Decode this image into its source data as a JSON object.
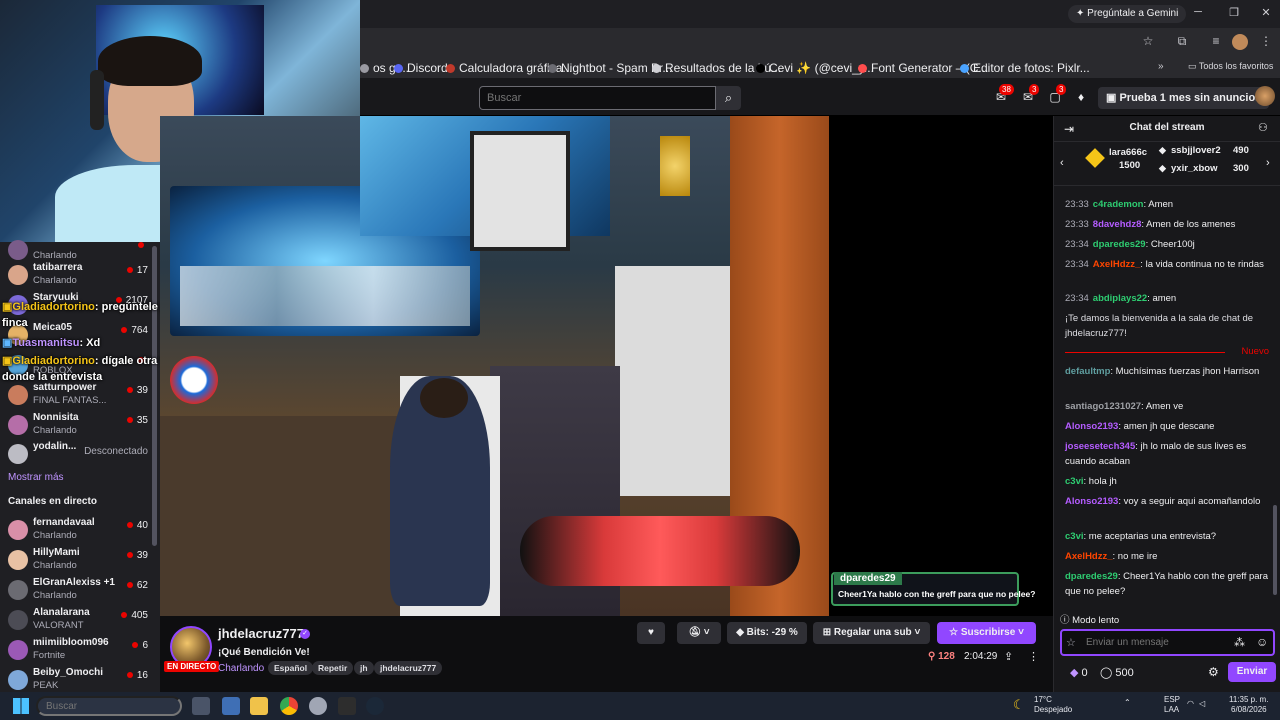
{
  "browser": {
    "gemini_label": "Pregúntale a Gemini",
    "bookmarks": [
      {
        "label": "os gr...",
        "color": "#9a9aa2"
      },
      {
        "label": "Discord",
        "color": "#5865f2"
      },
      {
        "label": "Calculadora gráfica...",
        "color": "#c0392b"
      },
      {
        "label": "Nightbot - Spam Pr...",
        "color": "#6b6b72"
      },
      {
        "label": "Resultados de la bú...",
        "color": "#cfcfd4"
      },
      {
        "label": "Cevi ✨ (@cevi_y...",
        "color": "#000000"
      },
      {
        "label": "Font Generator – (C...",
        "color": "#ff4d4d"
      },
      {
        "label": "Editor de fotos: Pixlr...",
        "color": "#4aa3ff"
      }
    ],
    "all_favorites": "Todos los favoritos"
  },
  "topnav": {
    "search_placeholder": "Buscar",
    "badges": [
      "38",
      "3",
      "3"
    ],
    "prime_label": "Prueba 1 mes sin anuncios"
  },
  "sidebar": {
    "followed": [
      {
        "name": "",
        "game": "Charlando",
        "viewers": "",
        "color": "#7a5c8a"
      },
      {
        "name": "tatibarrera",
        "game": "Charlando",
        "viewers": "17",
        "color": "#d9a58a"
      },
      {
        "name": "Staryuuki",
        "game": "",
        "viewers": "2107",
        "color": "#7d6ad9"
      },
      {
        "name": "Meica05",
        "game": "",
        "viewers": "764",
        "color": "#e4b266"
      },
      {
        "name": "",
        "game": "ROBLOX",
        "viewers": "",
        "color": "#54a3d8"
      },
      {
        "name": "satturnpower",
        "game": "FINAL FANTAS...",
        "viewers": "39",
        "color": "#c97c5d"
      },
      {
        "name": "Nonnisita",
        "game": "Charlando",
        "viewers": "35",
        "color": "#b56ea8"
      },
      {
        "name": "yodalin...",
        "game": "",
        "viewers": "Desconectado",
        "color": "#bcbcc4",
        "offline": true
      }
    ],
    "show_more": "Mostrar más",
    "live_header": "Canales en directo",
    "live": [
      {
        "name": "fernandavaal",
        "game": "Charlando",
        "viewers": "40",
        "color": "#d98fa8"
      },
      {
        "name": "HillyMami",
        "game": "Charlando",
        "viewers": "39",
        "color": "#e8c1a4"
      },
      {
        "name": "ElGranAlexiss +1",
        "game": "Charlando",
        "viewers": "62",
        "color": "#6b6b72"
      },
      {
        "name": "Alanalarana",
        "game": "VALORANT",
        "viewers": "405",
        "color": "#4c4c55"
      },
      {
        "name": "miimiibloom096",
        "game": "Fortnite",
        "viewers": "6",
        "color": "#9b59b6"
      },
      {
        "name": "Beiby_Omochi",
        "game": "PEAK",
        "viewers": "16",
        "color": "#7fa8d9"
      }
    ],
    "overlays": [
      {
        "user": "Gladiadortorino",
        "text": ": pregúntele por la"
      },
      {
        "user": "",
        "text": "finca"
      },
      {
        "user": "Tuasmanitsu",
        "text": ": Xd"
      },
      {
        "user": "Gladiadortorino",
        "text": ": dígale otra vez"
      },
      {
        "user": "",
        "text": "donde la entrevista"
      }
    ]
  },
  "video": {
    "alert_user": "dparedes29",
    "alert_msg": "Cheer1Ya hablo con the greff para que no pelee?"
  },
  "channel": {
    "name": "jhdelacruz777",
    "title": "¡Qué Bendición Ve!",
    "category": "Charlando",
    "live_badge": "EN DIRECTO",
    "tags": [
      "Español",
      "Repetir",
      "jh",
      "jhdelacruz777"
    ],
    "bits_label": "Bits: -29 %",
    "sub_box_label": "Regalar una sub",
    "subscribe_label": "Suscribirse",
    "viewers": "128",
    "uptime": "2:04:29"
  },
  "chat": {
    "header": "Chat del stream",
    "leaderboard": {
      "first": {
        "name": "lara666c",
        "amount": "1500"
      },
      "second": {
        "name": "ssbjjlover2",
        "amount": "490"
      },
      "third": {
        "name": "yxir_xbow",
        "amount": "300"
      }
    },
    "messages_before": [
      {
        "time": "23:33",
        "user": "c4rademon",
        "color": "#2ecc71",
        "text": "Amen"
      },
      {
        "time": "23:33",
        "user": "8davehdz8",
        "color": "#b45cff",
        "text": "Amen de los amenes"
      },
      {
        "time": "23:34",
        "user": "dparedes29",
        "color": "#2ecc71",
        "text": "Cheer100j"
      },
      {
        "time": "23:34",
        "user": "AxelHdzz_",
        "color": "#ff4500",
        "text": "la vida continua no te rindas"
      },
      {
        "time": "23:34",
        "user": "abdiplays22",
        "color": "#2ecc71",
        "text": "amen"
      }
    ],
    "welcome": "¡Te damos la bienvenida a la sala de chat de jhdelacruz777!",
    "new_label": "Nuevo",
    "messages_after": [
      {
        "user": "defaultmp",
        "color": "#5f9ea0",
        "text": "Muchísimas fuerzas jhon Harrison"
      },
      {
        "user": "santiago1231027",
        "color": "#9ea0a5",
        "text": "Amen ve"
      },
      {
        "user": "Alonso2193",
        "color": "#b45cff",
        "text": "amen jh que descane"
      },
      {
        "user": "joseesetech345",
        "color": "#b45cff",
        "text": "jh lo malo de sus lives es cuando acaban"
      },
      {
        "user": "c3vi",
        "color": "#2ecc71",
        "text": "hola jh"
      },
      {
        "user": "Alonso2193",
        "color": "#b45cff",
        "text": "voy a seguir aqui acomañandolo"
      },
      {
        "user": "c3vi",
        "color": "#2ecc71",
        "text": "me aceptarias una entrevista?"
      },
      {
        "user": "AxelHdzz_",
        "color": "#ff4500",
        "text": "no me ire"
      },
      {
        "user": "dparedes29",
        "color": "#2ecc71",
        "text": "Cheer1Ya hablo con the greff para que no pelee?"
      }
    ],
    "slow_mode": "Modo lento",
    "input_placeholder": "Enviar un mensaje",
    "bits_count": "0",
    "points": "500",
    "send_label": "Enviar"
  },
  "taskbar": {
    "search_placeholder": "Buscar",
    "weather_temp": "17°C",
    "weather_desc": "Despejado",
    "lang1": "ESP",
    "lang2": "LAA",
    "time": "11:35 p. m.",
    "date": "6/08/2026"
  }
}
